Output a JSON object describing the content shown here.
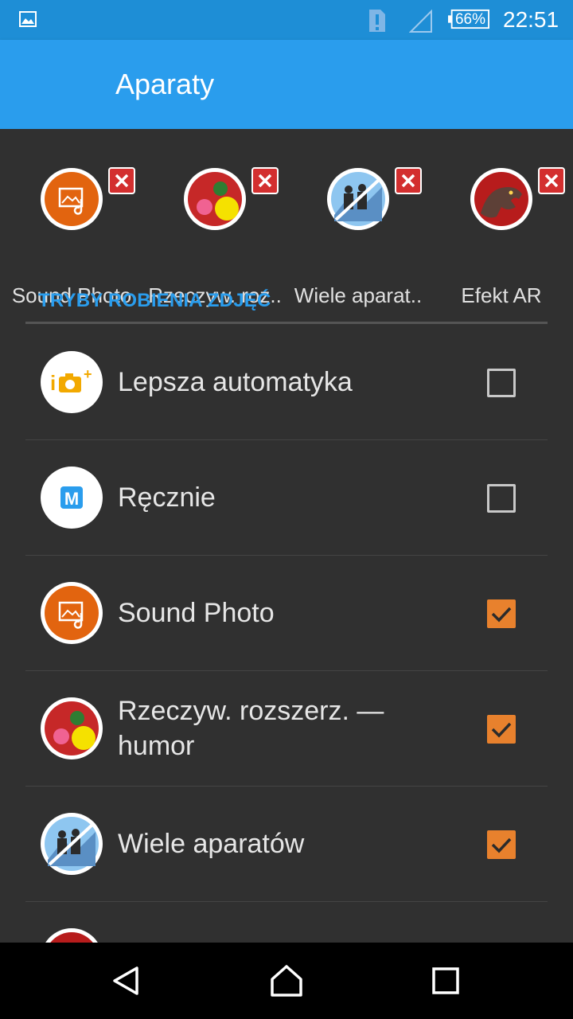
{
  "status_bar": {
    "icons": [
      "gallery-icon",
      "sim-alert-icon",
      "signal-icon",
      "battery-icon"
    ],
    "battery": "66%",
    "time": "22:51",
    "color": "#1E8ED6"
  },
  "app_bar": {
    "title": "Aparaty",
    "color": "#2A9DED"
  },
  "active_modes": [
    {
      "label": "Sound Photo",
      "icon": "sound-photo-icon"
    },
    {
      "label": "Rzeczyw. roz..",
      "icon": "ar-fun-icon"
    },
    {
      "label": "Wiele aparat..",
      "icon": "multi-camera-icon"
    },
    {
      "label": "Efekt AR",
      "icon": "ar-effect-icon"
    }
  ],
  "section": {
    "title": "TRYBY ROBIENIA ZDJĘĆ"
  },
  "modes": [
    {
      "label": "Lepsza automatyka",
      "icon": "superior-auto-icon",
      "checked": false
    },
    {
      "label": "Ręcznie",
      "icon": "manual-icon",
      "checked": false
    },
    {
      "label": "Sound Photo",
      "icon": "sound-photo-icon",
      "checked": true
    },
    {
      "label": "Rzeczyw. rozszerz. — humor",
      "icon": "ar-fun-icon",
      "checked": true
    },
    {
      "label": "Wiele aparatów",
      "icon": "multi-camera-icon",
      "checked": true
    }
  ],
  "accent_color": "#E8812D",
  "nav_bar": {
    "buttons": [
      "back-icon",
      "home-icon",
      "recents-icon"
    ]
  }
}
